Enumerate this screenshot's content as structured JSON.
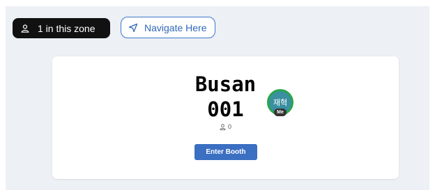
{
  "zone": {
    "count_label": "1 in this zone",
    "icon": "person-icon"
  },
  "navigate": {
    "label": "Navigate Here",
    "icon": "navigation-arrow-icon",
    "color": "#3a78c9"
  },
  "booth": {
    "title_line1": "Busan",
    "title_line2": "001",
    "occupant_count": "0",
    "enter_label": "Enter Booth",
    "enter_color": "#3a6fc2"
  },
  "avatar": {
    "initials": "재혁",
    "badge": "Me",
    "ring_color": "#2aa64b",
    "bg_color": "#3a8fa0"
  },
  "colors": {
    "background": "#edf0f5",
    "card": "#ffffff",
    "pill": "#111111"
  }
}
